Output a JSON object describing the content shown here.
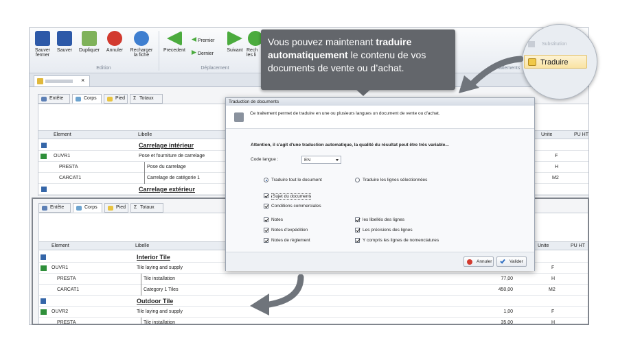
{
  "ribbon": {
    "buttons": [
      {
        "label": "Sauver fermer",
        "icon": "save-close-icon"
      },
      {
        "label": "Sauver",
        "icon": "save-icon"
      },
      {
        "label": "Dupliquer",
        "icon": "duplicate-icon"
      },
      {
        "label": "Annuler",
        "icon": "cancel-icon"
      },
      {
        "label": "Recharger la fiche",
        "icon": "reload-icon"
      },
      {
        "label": "Precedent",
        "icon": "previous-icon"
      },
      {
        "label": "Premier",
        "icon": "first-icon"
      },
      {
        "label": "Dernier",
        "icon": "last-icon"
      },
      {
        "label": "Suivant",
        "icon": "next-icon"
      },
      {
        "label": "Rech les li",
        "icon": "refresh-icon"
      }
    ],
    "groups": {
      "edition": "Edition",
      "deplacement": "Déplacement",
      "traitements": "Traitements"
    }
  },
  "doc_tab": {
    "close": "×"
  },
  "tooltip": {
    "line1_prefix": "Vous pouvez maintenant ",
    "line1_bold": "traduire",
    "line2_bold": "automatiquement",
    "line2_rest": " le contenu de vos",
    "line3": "documents de vente ou d’achat."
  },
  "magnifier": {
    "button": "Traduire",
    "faded": "Substitution"
  },
  "tabs": [
    "Entête",
    "Corps",
    "Pied",
    "Totaux"
  ],
  "grid_headers": {
    "element": "Element",
    "libelle": "Libelle",
    "unite": "Unite",
    "pu": "PU HT"
  },
  "top_grid": {
    "rows": [
      {
        "type": "title",
        "libelle": "Carrelage intérieur"
      },
      {
        "element": "OUVR1",
        "libelle": "Pose et fourniture de carrelage",
        "unite": "F"
      },
      {
        "element": "PRESTA",
        "libelle": "Pose du carrelage",
        "unite": "H"
      },
      {
        "element": "CARCAT1",
        "libelle": "Carrelage de catégorie 1",
        "unite": "M2"
      },
      {
        "type": "title",
        "libelle": "Carrelage extérieur"
      }
    ]
  },
  "bottom_grid": {
    "rows": [
      {
        "type": "title",
        "libelle": "Interior Tile"
      },
      {
        "element": "OUVR1",
        "libelle": "Tile laying and supply",
        "qty": "",
        "unite": "F"
      },
      {
        "element": "PRESTA",
        "libelle": "Tile installation",
        "qty": "77,00",
        "unite": "H"
      },
      {
        "element": "CARCAT1",
        "libelle": "Category 1 Tiles",
        "qty": "450,00",
        "unite": "M2"
      },
      {
        "type": "title",
        "libelle": "Outdoor Tile"
      },
      {
        "element": "OUVR2",
        "libelle": "Tile laying and supply",
        "qty": "1,00",
        "unite": "F"
      },
      {
        "element": "PRESTA",
        "libelle": "Tile installation",
        "qty": "35,00",
        "unite": "H"
      }
    ]
  },
  "dialog": {
    "title": "Traduction de documents",
    "description": "Ce traitement permet de traduire en une ou plusieurs langues un document de vente ou d'achat.",
    "warning": "Attention, il s'agit d'une traduction automatique, la qualité du résultat peut  être très variable...",
    "lang_label": "Code langue :",
    "lang_value": "EN",
    "radio_all": "Traduire tout le document",
    "radio_selected": "Traduire les lignes sélectionnées",
    "chk_sujet": "Sujet du document",
    "chk_conditions": "Conditions commerciales",
    "chk_notes": "Notes",
    "chk_libelles": "les libellés des lignes",
    "chk_expedition": "Notes d'expédition",
    "chk_precisions": "Les précisions des lignes",
    "chk_reglement": "Notes de règlement",
    "chk_nomenclatures": "Y compris les lignes de nomenclatures",
    "btn_cancel": "Annuler",
    "btn_ok": "Valider"
  }
}
